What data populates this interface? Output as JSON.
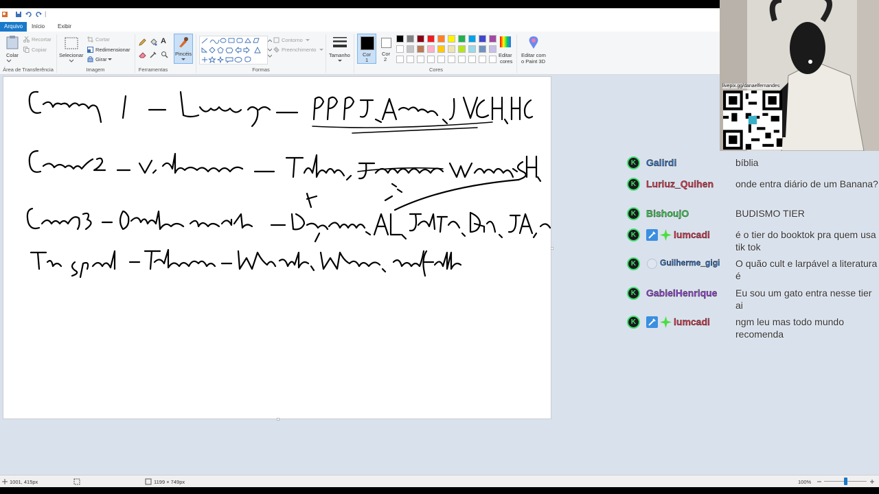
{
  "titlebar": {
    "sep": "|"
  },
  "tabs": [
    {
      "label": "Arquivo"
    },
    {
      "label": "Início"
    },
    {
      "label": "Exibir"
    }
  ],
  "ribbon": {
    "clipboard": {
      "paste": "Colar",
      "cut": "Recortar",
      "copy": "Copiar",
      "group": "Área de Transferência"
    },
    "image": {
      "select": "Selecionar",
      "crop": "Cortar",
      "resize": "Redimensionar",
      "rotate": "Girar",
      "group": "Imagem"
    },
    "tools": {
      "group": "Ferramentas",
      "text_tool": "A"
    },
    "brushes": {
      "label": "Pincéis"
    },
    "shapes": {
      "outline": "Contorno",
      "fill": "Preenchimento",
      "group": "Formas"
    },
    "size": {
      "label": "Tamanho"
    },
    "color1": {
      "line1": "Cor",
      "line2": "1"
    },
    "color2": {
      "line1": "Cor",
      "line2": "2"
    },
    "colors": {
      "group": "Cores"
    },
    "edit_colors": {
      "line1": "Editar",
      "line2": "cores"
    },
    "paint3d": {
      "line1": "Editar com",
      "line2": "o Paint 3D"
    },
    "palette_row1": [
      "#000000",
      "#7f7f7f",
      "#880015",
      "#ed1c24",
      "#ff7f27",
      "#fff200",
      "#22b14c",
      "#00a2e8",
      "#3f48cc",
      "#a349a4"
    ],
    "palette_row2": [
      "#ffffff",
      "#c3c3c3",
      "#b97a57",
      "#ffaec9",
      "#ffc90e",
      "#efe4b0",
      "#b5e61d",
      "#99d9ea",
      "#7092be",
      "#c8bfe7"
    ]
  },
  "status": {
    "cursor_pos": "1001, 415px",
    "canvas_size": "1199 × 749px",
    "zoom": "100%",
    "zoom_fraction": 0.5
  },
  "webcam": {
    "url": "livepix.gg/danaelfernandes"
  },
  "chat": [
    {
      "name": "Galirdi",
      "color": "#3a7fd4",
      "message": "bíblia",
      "badges": []
    },
    {
      "name": "Luriuz_Quihen",
      "color": "#e0425a",
      "message": "onde entra diário de um Banana?",
      "badges": []
    },
    {
      "name": "BishoujO",
      "color": "#3fd65e",
      "message": "BUDISMO TIER",
      "badges": []
    },
    {
      "name": "lumcadi",
      "color": "#e0425a",
      "message": "é o tier do booktok pra quem usa tik tok",
      "badges": [
        "sword",
        "sparkle"
      ]
    },
    {
      "name": "Guilherme_gigi",
      "color": "#3a7fd4",
      "message": "O quão cult e larpável a literatura é",
      "badges": [
        "circle"
      ]
    },
    {
      "name": "GabielHenrique",
      "color": "#9b4fe0",
      "message": "Eu sou um gato entra nesse tier ai",
      "badges": []
    },
    {
      "name": "lumcadi",
      "color": "#e0425a",
      "message": "ngm leu mas todo mundo recomenda",
      "badges": [
        "sword",
        "sparkle"
      ]
    }
  ],
  "chat_badge_glyph": "K"
}
